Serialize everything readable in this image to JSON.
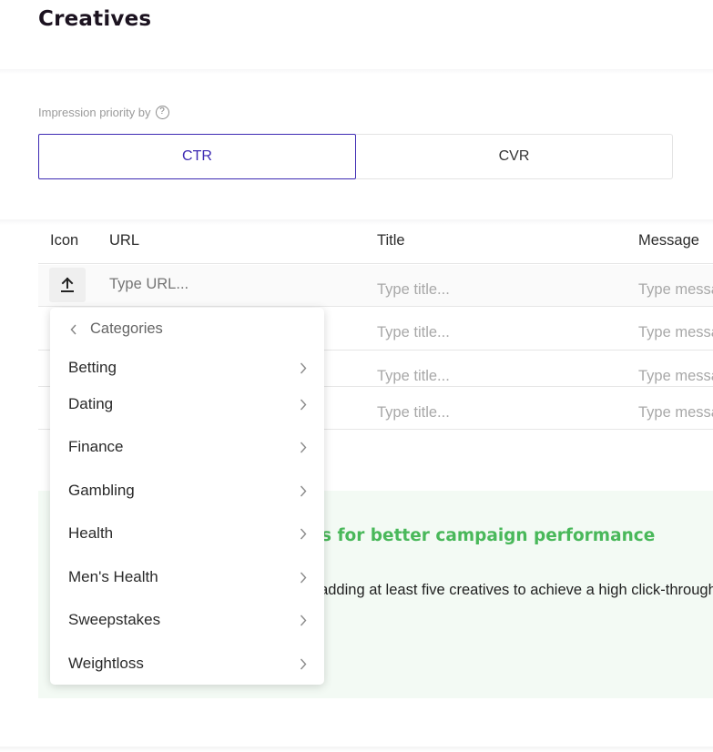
{
  "page": {
    "title": "Creatives"
  },
  "priority": {
    "label": "Impression priority by",
    "help_icon": "?",
    "options": [
      {
        "label": "CTR",
        "selected": true
      },
      {
        "label": "CVR",
        "selected": false
      }
    ]
  },
  "table": {
    "headers": {
      "icon": "Icon",
      "url": "URL",
      "title": "Title",
      "message": "Message"
    },
    "url_placeholder": "Type URL...",
    "rows": [
      {
        "title": "Type title...",
        "message": "Type message..."
      },
      {
        "title": "Type title...",
        "message": "Type message..."
      },
      {
        "title": "Type title...",
        "message": "Type message..."
      },
      {
        "title": "Type title...",
        "message": "Type message..."
      }
    ]
  },
  "dropdown": {
    "header": "Categories",
    "items": [
      {
        "label": "Betting"
      },
      {
        "label": "Dating"
      },
      {
        "label": "Finance"
      },
      {
        "label": "Gambling"
      },
      {
        "label": "Health"
      },
      {
        "label": "Men's Health"
      },
      {
        "label": "Sweepstakes"
      },
      {
        "label": "Weightloss"
      }
    ]
  },
  "tip": {
    "title": "s for better campaign performance",
    "body": "r adding at least five creatives to achieve a high click-through rate"
  },
  "colors": {
    "accent": "#3d2ab3",
    "tip_green": "#49b85a",
    "tip_bg": "#f3faf4"
  },
  "icons": {
    "upload": "upload-icon",
    "back": "chevron-left-icon",
    "forward": "chevron-right-icon",
    "help": "help-circle-icon"
  }
}
